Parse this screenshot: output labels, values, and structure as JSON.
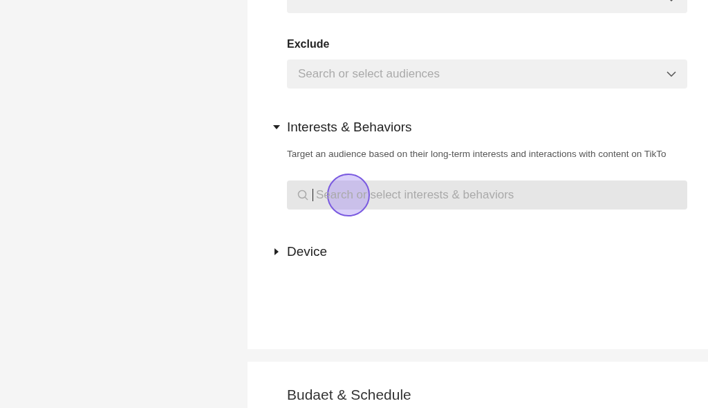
{
  "audience_card": {
    "top_field": {
      "kind": "dropdown"
    },
    "exclude": {
      "label": "Exclude",
      "placeholder": "Search or select audiences",
      "focused": false
    },
    "sections": [
      {
        "title": "Interests & Behaviors",
        "expanded": true,
        "description": "Target an audience based on their long-term interests and interactions with content on TikTo",
        "search": {
          "placeholder": "Search or select interests & behaviors",
          "focused": true
        }
      },
      {
        "title": "Device",
        "expanded": false
      }
    ]
  },
  "budget_card": {
    "title": "Budaet & Schedule"
  }
}
